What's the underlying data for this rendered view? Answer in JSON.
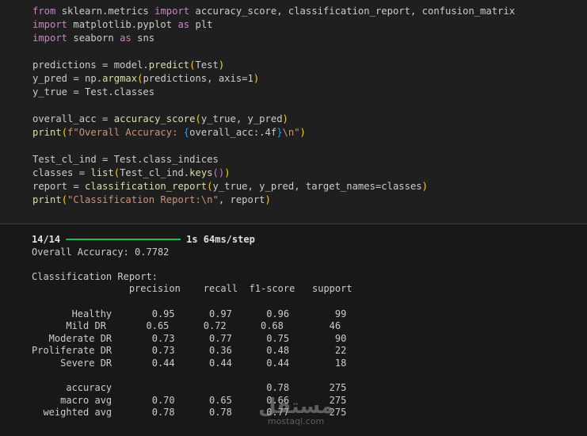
{
  "code_cell": {
    "lines": [
      [
        {
          "t": "from",
          "c": "kw"
        },
        {
          "t": " sklearn.metrics ",
          "c": ""
        },
        {
          "t": "import",
          "c": "kw"
        },
        {
          "t": " accuracy_score, classification_report, confusion_matrix",
          "c": ""
        }
      ],
      [
        {
          "t": "import",
          "c": "kw"
        },
        {
          "t": " matplotlib.pyplot ",
          "c": ""
        },
        {
          "t": "as",
          "c": "kw"
        },
        {
          "t": " plt",
          "c": ""
        }
      ],
      [
        {
          "t": "import",
          "c": "kw"
        },
        {
          "t": " seaborn ",
          "c": ""
        },
        {
          "t": "as",
          "c": "kw"
        },
        {
          "t": " sns",
          "c": ""
        }
      ],
      [],
      [
        {
          "t": "predictions = model.",
          "c": ""
        },
        {
          "t": "predict",
          "c": "fn"
        },
        {
          "t": "(",
          "c": "paren"
        },
        {
          "t": "Test",
          "c": ""
        },
        {
          "t": ")",
          "c": "paren"
        }
      ],
      [
        {
          "t": "y_pred = np.",
          "c": ""
        },
        {
          "t": "argmax",
          "c": "fn"
        },
        {
          "t": "(",
          "c": "paren"
        },
        {
          "t": "predictions, axis=1",
          "c": ""
        },
        {
          "t": ")",
          "c": "paren"
        }
      ],
      [
        {
          "t": "y_true = Test.classes",
          "c": ""
        }
      ],
      [],
      [
        {
          "t": "overall_acc = ",
          "c": ""
        },
        {
          "t": "accuracy_score",
          "c": "fn"
        },
        {
          "t": "(",
          "c": "paren"
        },
        {
          "t": "y_true, y_pred",
          "c": ""
        },
        {
          "t": ")",
          "c": "paren"
        }
      ],
      [
        {
          "t": "print",
          "c": "fn"
        },
        {
          "t": "(",
          "c": "paren"
        },
        {
          "t": "f\"Overall Accuracy: ",
          "c": "str"
        },
        {
          "t": "{",
          "c": "brace"
        },
        {
          "t": "overall_acc:.4f",
          "c": ""
        },
        {
          "t": "}",
          "c": "brace"
        },
        {
          "t": "\\n\"",
          "c": "str"
        },
        {
          "t": ")",
          "c": "paren"
        }
      ],
      [],
      [
        {
          "t": "Test_cl_ind = Test.class_indices",
          "c": ""
        }
      ],
      [
        {
          "t": "classes = ",
          "c": ""
        },
        {
          "t": "list",
          "c": "fn"
        },
        {
          "t": "(",
          "c": "paren"
        },
        {
          "t": "Test_cl_ind.",
          "c": ""
        },
        {
          "t": "keys",
          "c": "fn"
        },
        {
          "t": "()",
          "c": "paren2"
        },
        {
          "t": ")",
          "c": "paren"
        }
      ],
      [
        {
          "t": "report = ",
          "c": ""
        },
        {
          "t": "classification_report",
          "c": "fn"
        },
        {
          "t": "(",
          "c": "paren"
        },
        {
          "t": "y_true, y_pred, target_names=classes",
          "c": ""
        },
        {
          "t": ")",
          "c": "paren"
        }
      ],
      [
        {
          "t": "print",
          "c": "fn"
        },
        {
          "t": "(",
          "c": "paren"
        },
        {
          "t": "\"Classification Report:\\n\"",
          "c": "str"
        },
        {
          "t": ", report",
          "c": ""
        },
        {
          "t": ")",
          "c": "paren"
        }
      ]
    ]
  },
  "output": {
    "progress_line": {
      "steps": "14/14",
      "bar": "━━━━━━━━━━━━━━━━━━━━",
      "timing": "1s 64ms/step"
    },
    "lines": [
      "Overall Accuracy: 0.7782",
      "",
      "Classification Report:",
      "                 precision    recall  f1-score   support",
      "",
      "       Healthy       0.95      0.97      0.96        99",
      "      Mild DR       0.65      0.72      0.68        46",
      "   Moderate DR       0.73      0.77      0.75        90",
      "Proliferate DR       0.73      0.36      0.48        22",
      "     Severe DR       0.44      0.44      0.44        18",
      "",
      "      accuracy                           0.78       275",
      "     macro avg       0.70      0.65      0.66       275",
      "  weighted avg       0.78      0.78      0.77       275"
    ]
  },
  "watermark": {
    "arabic": "مستقل",
    "latin": "mostaql.com"
  }
}
